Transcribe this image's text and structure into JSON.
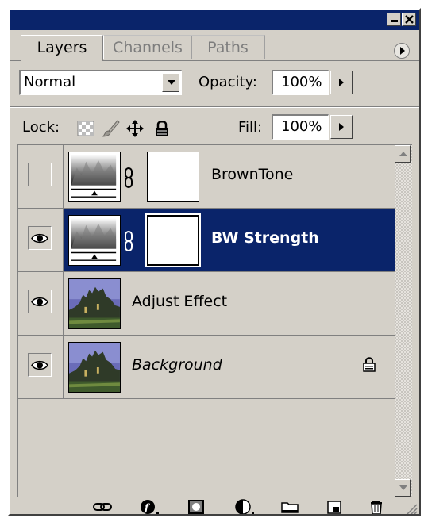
{
  "tabs": [
    {
      "label": "Layers",
      "active": true
    },
    {
      "label": "Channels",
      "active": false
    },
    {
      "label": "Paths",
      "active": false
    }
  ],
  "blend_mode": {
    "value": "Normal"
  },
  "opacity": {
    "label": "Opacity:",
    "value": "100%"
  },
  "lock": {
    "label": "Lock:"
  },
  "fill": {
    "label": "Fill:",
    "value": "100%"
  },
  "layers": [
    {
      "name": "BrownTone",
      "visible": false,
      "selected": false,
      "type": "adjustment"
    },
    {
      "name": "BW Strength",
      "visible": true,
      "selected": true,
      "type": "adjustment"
    },
    {
      "name": "Adjust Effect",
      "visible": true,
      "selected": false,
      "type": "image"
    },
    {
      "name": "Background",
      "visible": true,
      "selected": false,
      "type": "image",
      "locked": true
    }
  ],
  "bottom_icons": [
    "link-icon",
    "layer-style-icon",
    "add-mask-icon",
    "adjustment-layer-icon",
    "new-group-icon",
    "new-layer-icon",
    "trash-icon"
  ],
  "colors": {
    "titlebar": "#0a246a",
    "selection": "#0a246a",
    "panel": "#d4d0c8"
  }
}
